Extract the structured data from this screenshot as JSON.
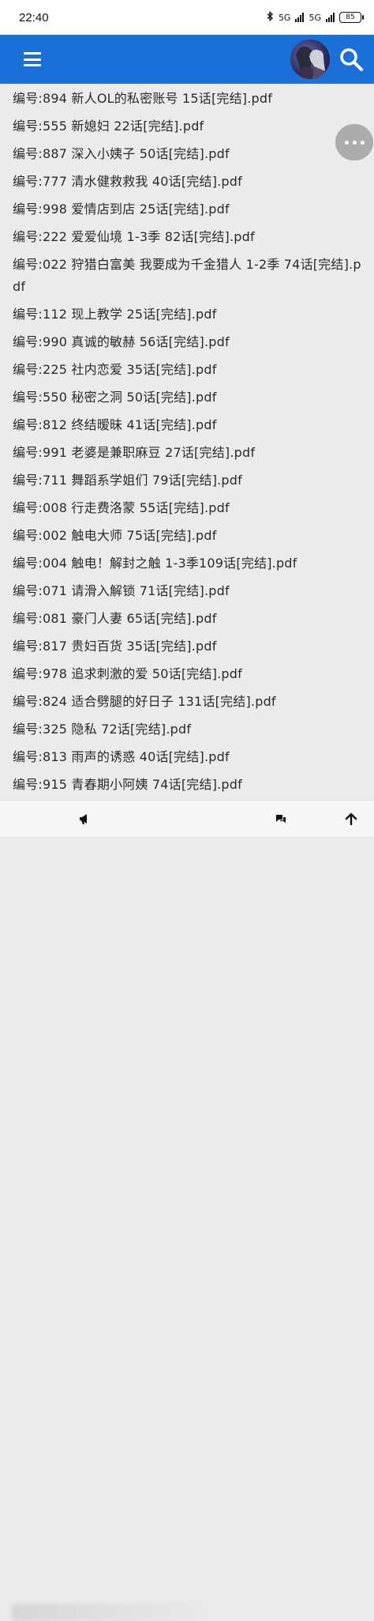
{
  "status_bar": {
    "time": "22:40",
    "network1": "5G",
    "network2": "5G",
    "battery": "85"
  },
  "app_bar": {
    "menu_icon": "menu-icon",
    "avatar": "anime-avatar",
    "search_icon": "search-icon"
  },
  "files": [
    "编号:894  新人OL的私密账号 15话[完结].pdf",
    "编号:555  新媳妇 22话[完结].pdf",
    "编号:887  深入小姨子 50话[完结].pdf",
    "编号:777  清水健救救我 40话[完结].pdf",
    "编号:998  爱情店到店 25话[完结].pdf",
    "编号:222  爱爱仙境 1-3季 82话[完结].pdf",
    "编号:022  狩猎白富美 我要成为千金猎人 1-2季 74话[完结].pdf",
    "编号:112  现上教学 25话[完结].pdf",
    "编号:990  真诚的敏赫 56话[完结].pdf",
    "编号:225  社内恋爱 35话[完结].pdf",
    "编号:550  秘密之洞 50话[完结].pdf",
    "编号:812  终结暧昧 41话[完结].pdf",
    "编号:991  老婆是兼职麻豆 27话[完结].pdf",
    "编号:711  舞蹈系学姐们 79话[完结].pdf",
    "编号:008  行走费洛蒙 55话[完结].pdf",
    "编号:002  触电大师 75话[完结].pdf",
    "编号:004  触电！解封之触 1-3季109话[完结].pdf",
    "编号:071  请滑入解锁 71话[完结].pdf",
    "编号:081  豪门人妻 65话[完结].pdf",
    "编号:817  贵妇百货 35话[完结].pdf",
    "编号:978  追求刺激的爱 50话[完结].pdf",
    "编号:824  适合劈腿的好日子 131话[完结].pdf",
    "编号:325  隐私 72话[完结].pdf",
    "编号:813  雨声的诱惑 40话[完结].pdf",
    "编号:915  青春期小阿姨 74话[完结].pdf"
  ],
  "floating": {
    "more_icon": "more-horizontal-icon"
  },
  "bottom_bar": {
    "icons": [
      "megaphone-icon",
      "chat-icon",
      "arrow-up-icon"
    ]
  },
  "colors": {
    "app_bar": "#1a6fd9",
    "background": "#ebebeb"
  }
}
